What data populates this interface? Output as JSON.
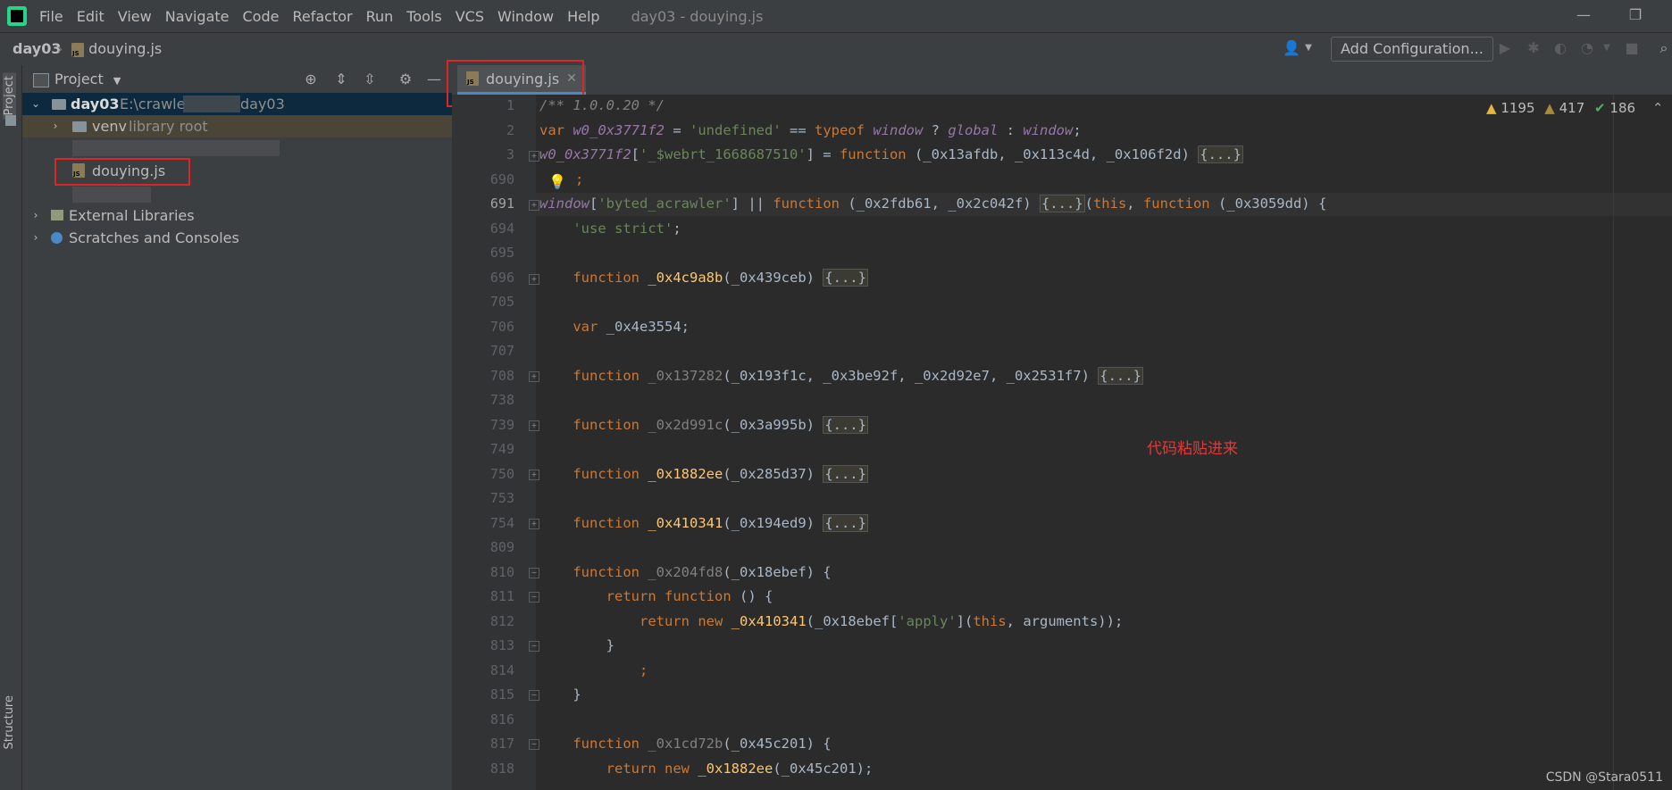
{
  "menubar": {
    "items": [
      "File",
      "Edit",
      "View",
      "Navigate",
      "Code",
      "Refactor",
      "Run",
      "Tools",
      "VCS",
      "Window",
      "Help"
    ],
    "window_title": "day03 - douying.js"
  },
  "navbar": {
    "project": "day03",
    "file": "douying.js",
    "add_configuration": "Add Configuration..."
  },
  "stripe": {
    "project_label": "Project",
    "structure_label": "Structure"
  },
  "project_panel": {
    "title": "Project",
    "root_name": "day03",
    "root_path_start": "E:\\crawle",
    "root_path_end": "day03",
    "venv_name": "venv",
    "venv_hint": "library root",
    "file_name": "douying.js",
    "external_libraries": "External Libraries",
    "scratches": "Scratches and Consoles"
  },
  "editor": {
    "tab_name": "douying.js",
    "stats": {
      "warnings": "1195",
      "weak_warnings": "417",
      "typos": "186"
    },
    "line_numbers": [
      "1",
      "2",
      "3",
      "690",
      "691",
      "694",
      "695",
      "696",
      "705",
      "706",
      "707",
      "708",
      "738",
      "739",
      "749",
      "750",
      "753",
      "754",
      "809",
      "810",
      "811",
      "812",
      "813",
      "814",
      "815",
      "816",
      "817",
      "818"
    ],
    "annotation": "代码粘贴进来"
  },
  "watermark": "CSDN @Stara0511",
  "colors": {
    "highlight": "#e02424",
    "accent": "#4a88c7",
    "keyword": "#cc7832",
    "string": "#6a8759",
    "function": "#ffc66d"
  }
}
